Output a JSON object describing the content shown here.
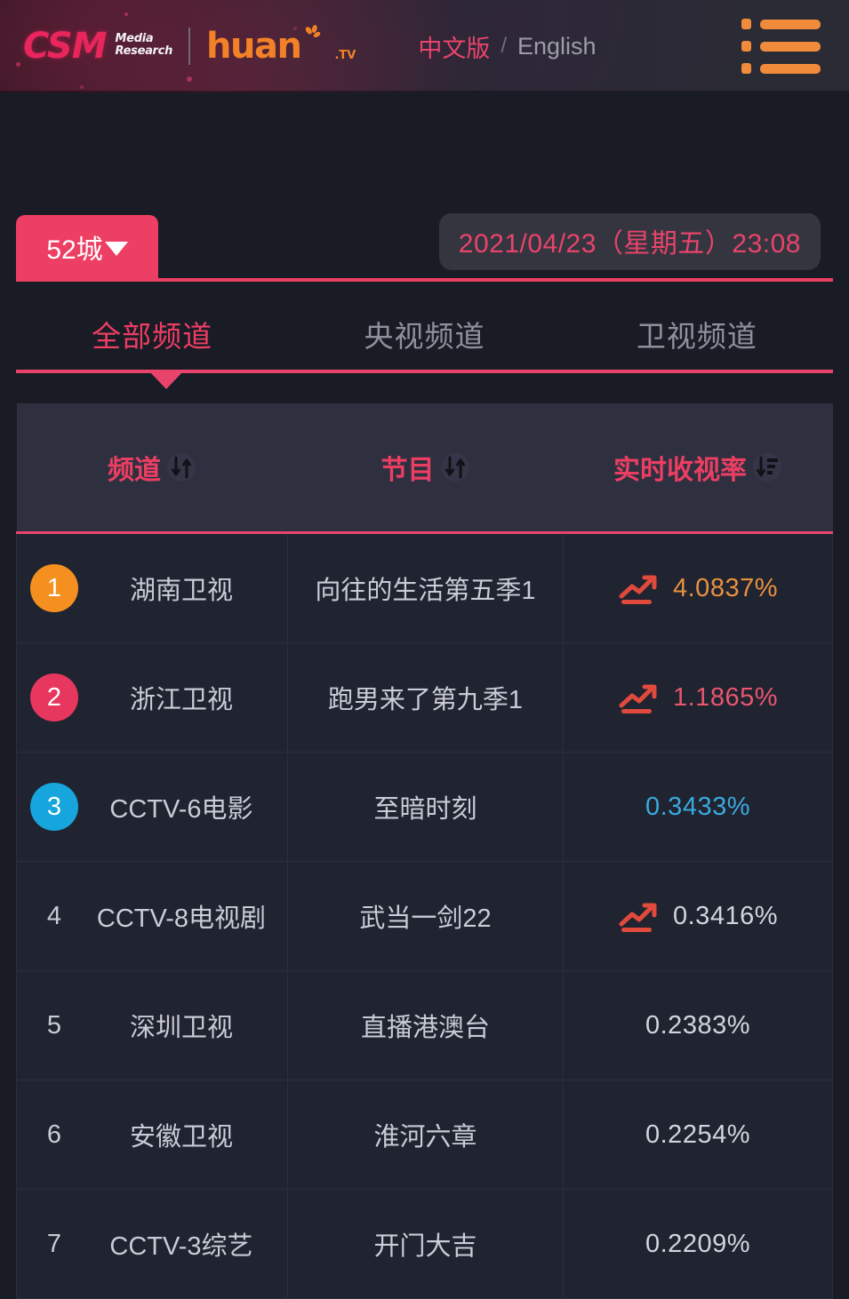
{
  "header": {
    "brand_primary": "CSM",
    "brand_sub_line1": "Media",
    "brand_sub_line2": "Research",
    "brand_secondary": "huan",
    "brand_secondary_tld": ".TV",
    "lang_cn": "中文版",
    "lang_sep": "/",
    "lang_en": "English",
    "menu_icon": "list-menu-icon",
    "accent_orange": "#f08b3c",
    "accent_pink": "#e8265c"
  },
  "controls": {
    "city_tab_label": "52城",
    "city_tab_caret": "caret-down-icon",
    "datetime": "2021/04/23（星期五）23:08"
  },
  "channel_tabs": [
    {
      "label": "全部频道",
      "active": true
    },
    {
      "label": "央视频道",
      "active": false
    },
    {
      "label": "卫视频道",
      "active": false
    }
  ],
  "table": {
    "columns": [
      {
        "label": "频道",
        "sort_icon": "sort-updown-icon"
      },
      {
        "label": "节目",
        "sort_icon": "sort-updown-icon"
      },
      {
        "label": "实时收视率",
        "sort_icon": "sort-descending-icon"
      }
    ],
    "rows": [
      {
        "rank": "1",
        "badge_color": "#f59020",
        "badge_style": "filled",
        "channel": "湖南卫视",
        "program": "向往的生活第五季1",
        "rate": "4.0837%",
        "rate_color": "#e8913f",
        "trend": "trending-up-icon"
      },
      {
        "rank": "2",
        "badge_color": "#e8375f",
        "badge_style": "filled",
        "channel": "浙江卫视",
        "program": "跑男来了第九季1",
        "rate": "1.1865%",
        "rate_color": "#e8566f",
        "trend": "trending-up-icon"
      },
      {
        "rank": "3",
        "badge_color": "#16a5dc",
        "badge_style": "filled",
        "channel": "CCTV-6电影",
        "program": "至暗时刻",
        "rate": "0.3433%",
        "rate_color": "#3aa9e0",
        "trend": null
      },
      {
        "rank": "4",
        "badge_color": "transparent",
        "badge_style": "plain",
        "channel": "CCTV-8电视剧",
        "program": "武当一剑22",
        "rate": "0.3416%",
        "rate_color": "#d2d5de",
        "trend": "trending-up-icon"
      },
      {
        "rank": "5",
        "badge_color": "transparent",
        "badge_style": "plain",
        "channel": "深圳卫视",
        "program": "直播港澳台",
        "rate": "0.2383%",
        "rate_color": "#d2d5de",
        "trend": null
      },
      {
        "rank": "6",
        "badge_color": "transparent",
        "badge_style": "plain",
        "channel": "安徽卫视",
        "program": "淮河六章",
        "rate": "0.2254%",
        "rate_color": "#d2d5de",
        "trend": null
      },
      {
        "rank": "7",
        "badge_color": "transparent",
        "badge_style": "plain",
        "channel": "CCTV-3综艺",
        "program": "开门大吉",
        "rate": "0.2209%",
        "rate_color": "#d2d5de",
        "trend": null
      }
    ]
  }
}
